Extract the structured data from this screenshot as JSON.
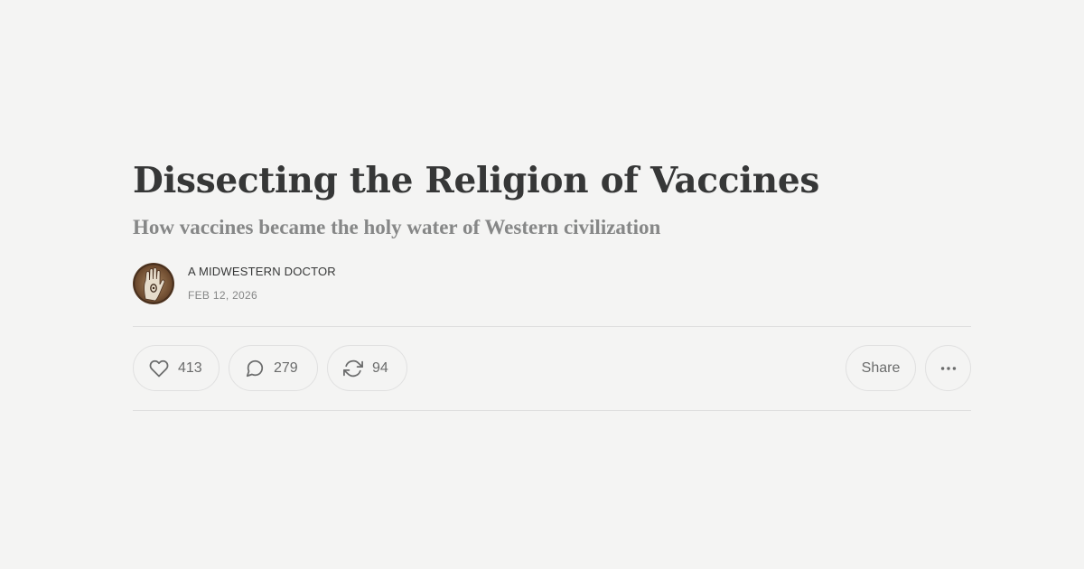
{
  "post": {
    "title": "Dissecting the Religion of Vaccines",
    "subtitle": "How vaccines became the holy water of Western civilization",
    "author": "A MIDWESTERN DOCTOR",
    "date": "FEB 12, 2026",
    "avatar": "hand-emblem-avatar"
  },
  "actions": {
    "likes": "413",
    "comments": "279",
    "restacks": "94",
    "share_label": "Share",
    "icons": {
      "like": "heart-icon",
      "comment": "speech-bubble-icon",
      "restack": "restack-arrows-icon",
      "more": "ellipsis-icon"
    }
  },
  "colors": {
    "background": "#f4f4f3",
    "text_primary": "#363737",
    "text_secondary": "#868787",
    "border": "#e0e0e0"
  }
}
